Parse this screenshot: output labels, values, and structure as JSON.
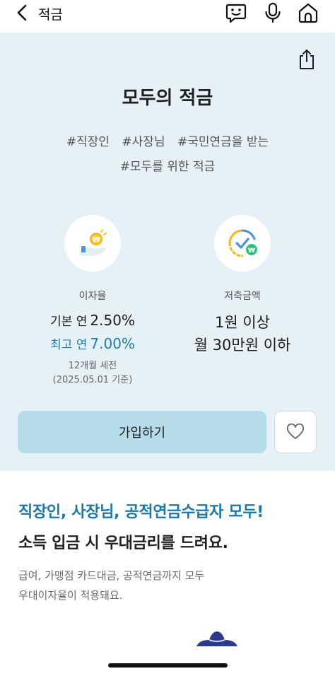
{
  "header": {
    "title": "적금",
    "icons": [
      "back-chevron-icon",
      "chatbot-icon",
      "microphone-icon",
      "home-icon"
    ]
  },
  "product": {
    "title": "모두의 적금",
    "tags_line1": [
      "#직장인",
      "#사장님",
      "#국민연금을 받는"
    ],
    "tags_line2": [
      "#모두를 위한 적금"
    ]
  },
  "rate": {
    "label": "이자율",
    "base_prefix": "기본 연",
    "base_value": "2.50%",
    "max_prefix": "최고 연",
    "max_value": "7.00%",
    "note_line1": "12개월 세전",
    "note_line2": "(2025.05.01 기준)"
  },
  "savings": {
    "label": "저축금액",
    "line1": "1원 이상",
    "line2": "월 30만원 이하"
  },
  "actions": {
    "join_label": "가입하기"
  },
  "promo": {
    "headline_blue": "직장인, 사장님, 공적연금수급자 모두!",
    "headline_dark": "소득 입금 시 우대금리를 드려요.",
    "desc_line1": "급여, 가맹점 카드대금, 공적연금까지 모두",
    "desc_line2": "우대이자율이 적용돼요."
  },
  "colors": {
    "hero_bg": "#e5f1f7",
    "accent_blue": "#1e7fb0",
    "join_button": "#b6dcea"
  }
}
